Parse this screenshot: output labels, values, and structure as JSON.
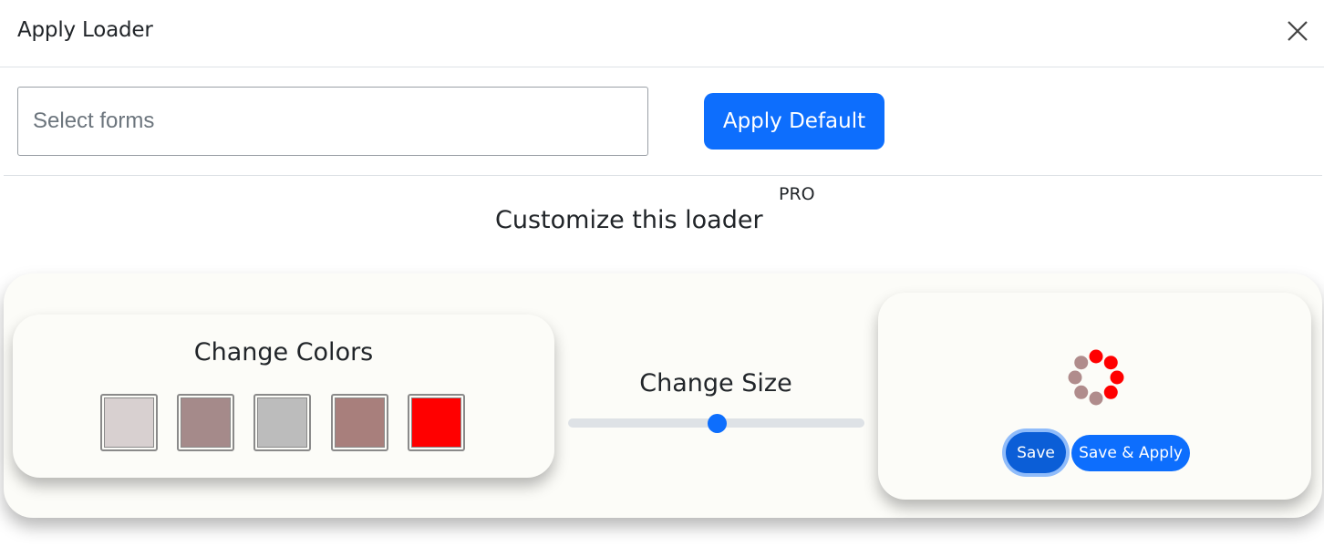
{
  "header": {
    "title": "Apply Loader",
    "close_icon": "close-icon"
  },
  "form": {
    "select_placeholder": "Select forms",
    "apply_default_label": "Apply Default"
  },
  "customize": {
    "heading": "Customize this loader",
    "badge": "PRO"
  },
  "colors": {
    "title": "Change Colors",
    "swatches": [
      "#d8d0d0",
      "#a58a8a",
      "#bcbcbc",
      "#a87f7c",
      "#ff0000"
    ]
  },
  "size": {
    "title": "Change Size",
    "value_fraction": 0.5
  },
  "preview": {
    "loader_icon": "spinner-dots-icon",
    "loader_colors": {
      "active": "#ff0000",
      "inactive": "#b08c8c"
    },
    "save_label": "Save",
    "save_apply_label": "Save & Apply"
  },
  "accent_color": "#0d6efd"
}
